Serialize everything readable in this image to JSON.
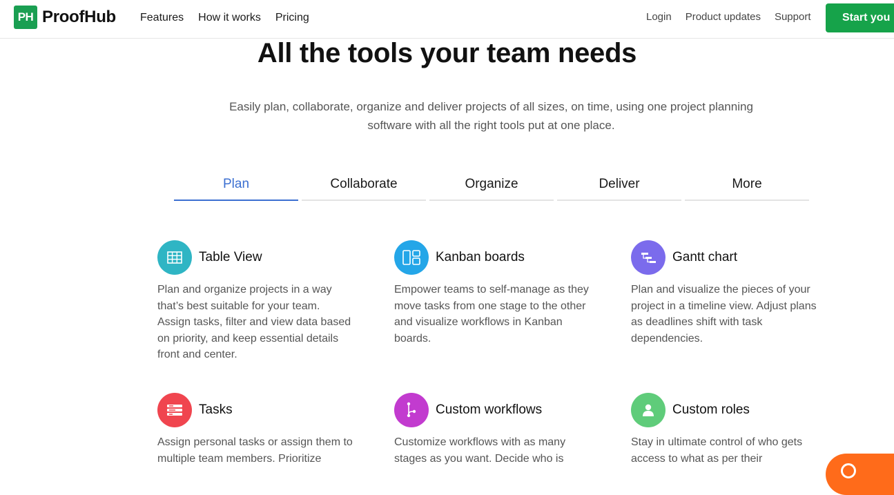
{
  "header": {
    "logo_mark": "PH",
    "logo_text": "ProofHub",
    "nav_left": [
      "Features",
      "How it works",
      "Pricing"
    ],
    "nav_right": [
      "Login",
      "Product updates",
      "Support"
    ],
    "cta_label": "Start you"
  },
  "hero": {
    "title": "All the tools your team needs",
    "subtitle": "Easily plan, collaborate, organize and deliver projects of all sizes, on time, using one project planning software with all the right tools put at one place."
  },
  "tabs": [
    {
      "label": "Plan",
      "active": true
    },
    {
      "label": "Collaborate",
      "active": false
    },
    {
      "label": "Organize",
      "active": false
    },
    {
      "label": "Deliver",
      "active": false
    },
    {
      "label": "More",
      "active": false
    }
  ],
  "features": [
    {
      "title": "Table View",
      "icon": "table-icon",
      "color": "#2fb5c4",
      "description": "Plan and organize projects in a way that’s best suitable for your team. Assign tasks, filter and view data based on priority, and keep essential details front and center."
    },
    {
      "title": "Kanban boards",
      "icon": "kanban-icon",
      "color": "#24a6e8",
      "description": "Empower teams to self-manage as they move tasks from one stage to the other and visualize workflows in Kanban boards."
    },
    {
      "title": "Gantt chart",
      "icon": "gantt-icon",
      "color": "#7b6bec",
      "description": "Plan and visualize the pieces of your project in a timeline view. Adjust plans as deadlines shift with task dependencies."
    },
    {
      "title": "Tasks",
      "icon": "tasks-icon",
      "color": "#f0454f",
      "description": "Assign personal tasks or assign them to multiple team members. Prioritize"
    },
    {
      "title": "Custom workflows",
      "icon": "workflow-icon",
      "color": "#c23bcf",
      "description": "Customize workflows with as many stages as you want. Decide who is"
    },
    {
      "title": "Custom roles",
      "icon": "user-icon",
      "color": "#5fcc7a",
      "description": "Stay in ultimate control of who gets access to what as per their"
    }
  ],
  "chat_icon": "chat-icon"
}
